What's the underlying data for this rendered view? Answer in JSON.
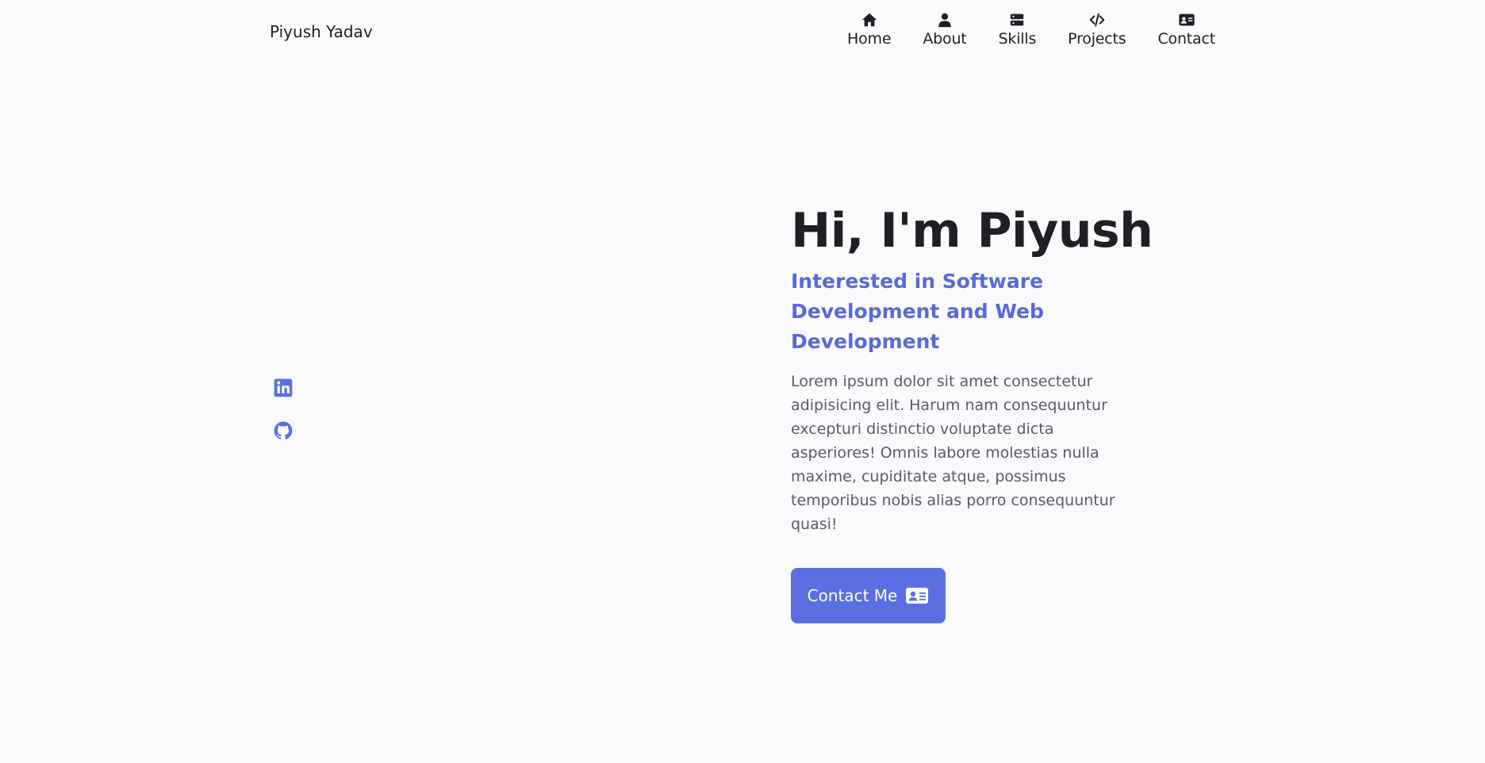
{
  "header": {
    "logo": "Piyush Yadav",
    "nav": [
      {
        "label": "Home",
        "icon": "home-icon"
      },
      {
        "label": "About",
        "icon": "user-icon"
      },
      {
        "label": "Skills",
        "icon": "layers-icon"
      },
      {
        "label": "Projects",
        "icon": "code-icon"
      },
      {
        "label": "Contact",
        "icon": "id-card-icon"
      }
    ]
  },
  "social": [
    {
      "icon": "linkedin-icon"
    },
    {
      "icon": "github-icon"
    }
  ],
  "hero": {
    "title": "Hi, I'm Piyush",
    "subtitle": "Interested in Software Development and Web Development",
    "description": "Lorem ipsum dolor sit amet consectetur adipisicing elit. Harum nam consequuntur excepturi distinctio voluptate dicta asperiores! Omnis labore molestias nulla maxime, cupiditate atque, possimus temporibus nobis alias porro consequuntur quasi!",
    "button_label": "Contact Me"
  },
  "colors": {
    "accent": "#5b6ee1",
    "subtitle": "#5869d9",
    "background": "#fafafc",
    "text": "#1f1f24"
  }
}
